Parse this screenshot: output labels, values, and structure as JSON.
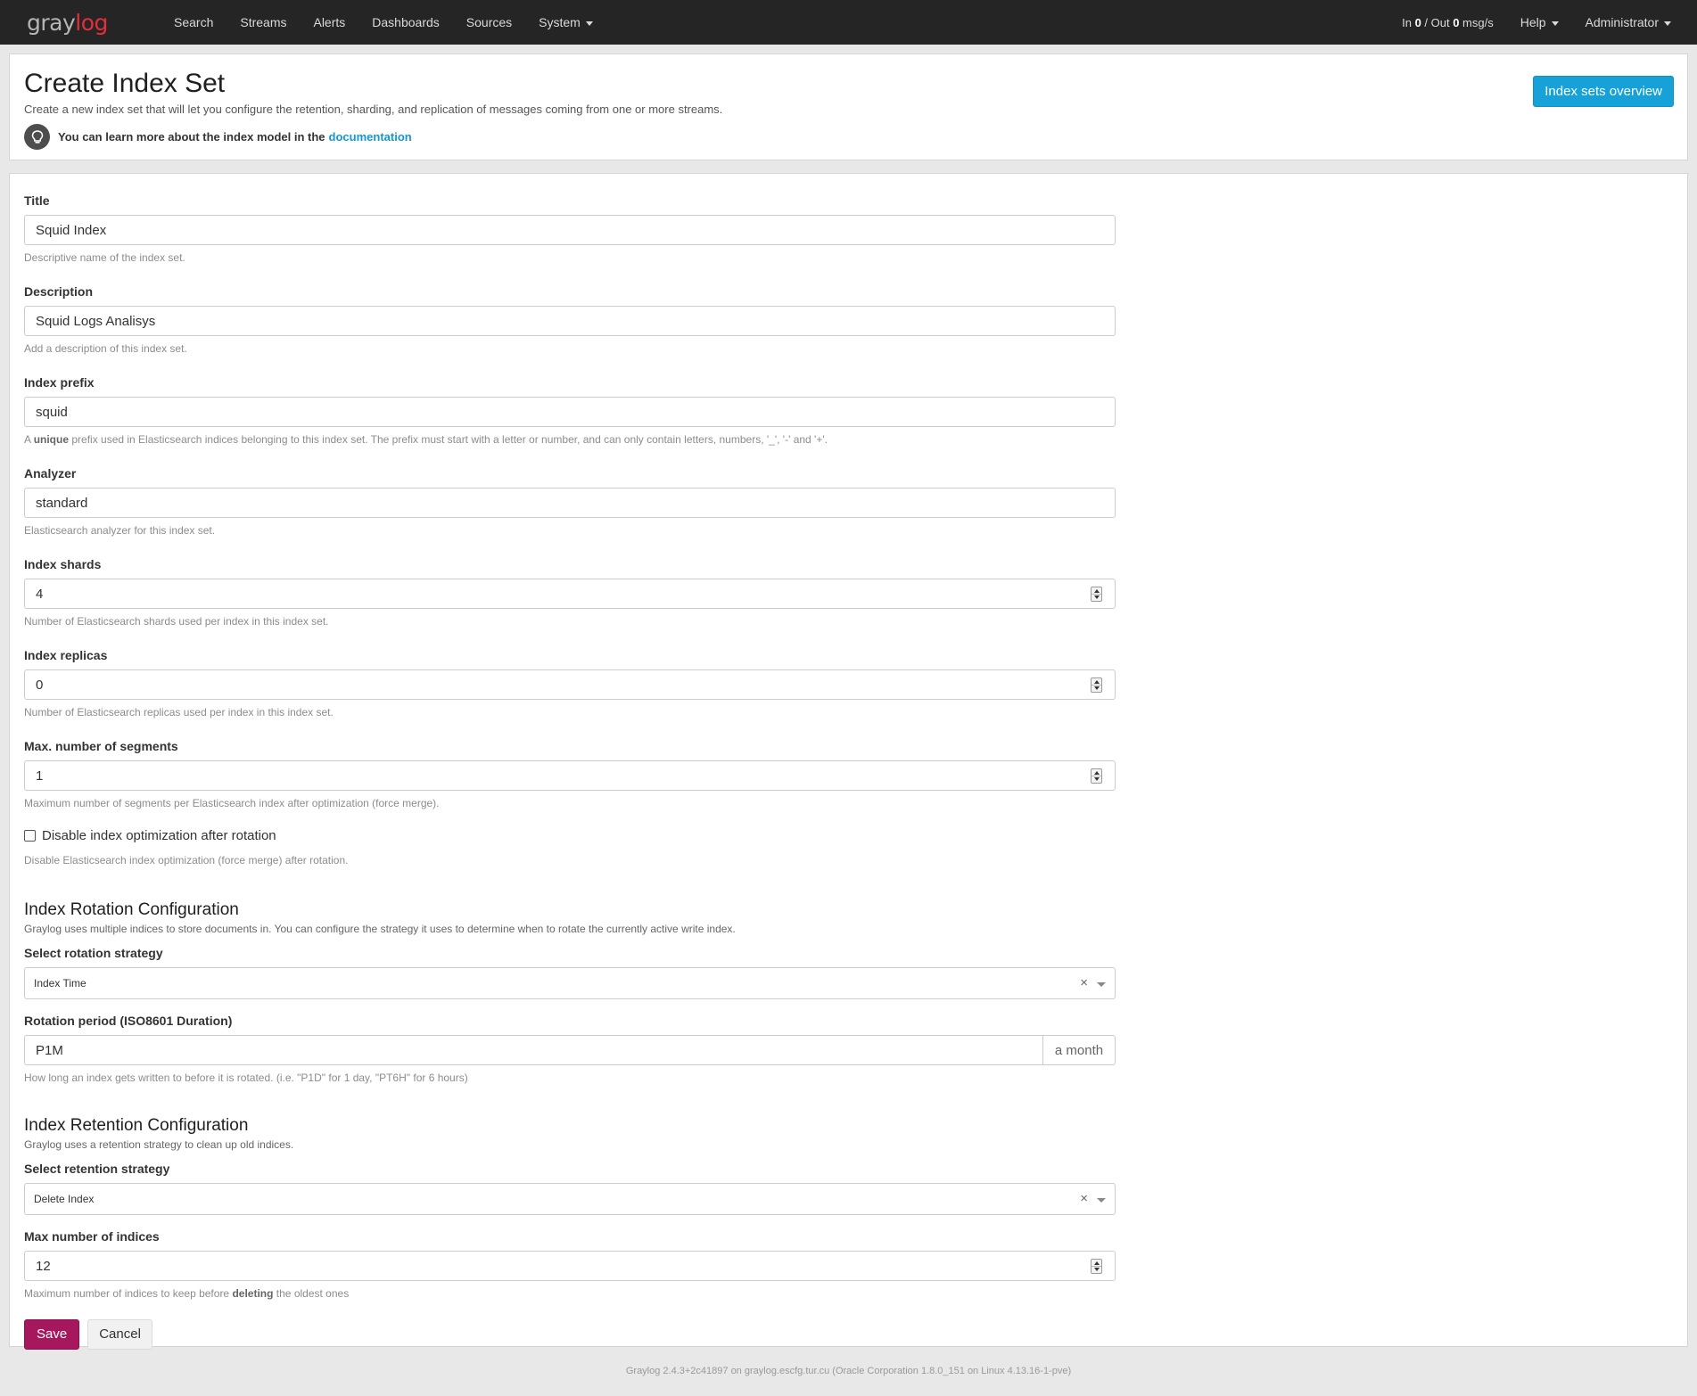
{
  "navbar": {
    "logo_part1": "gray",
    "logo_part2": "log",
    "items": [
      "Search",
      "Streams",
      "Alerts",
      "Dashboards",
      "Sources",
      "System"
    ],
    "throughput": {
      "in_label": "In ",
      "in_value": "0",
      "out_label": " / Out ",
      "out_value": "0",
      "unit": " msg/s"
    },
    "help": "Help",
    "user": "Administrator"
  },
  "header": {
    "title": "Create Index Set",
    "description": "Create a new index set that will let you configure the retention, sharding, and replication of messages coming from one or more streams.",
    "learn_text": "You can learn more about the index model in the",
    "learn_link": "documentation",
    "overview_button": "Index sets overview"
  },
  "form": {
    "title": {
      "label": "Title",
      "value": "Squid Index",
      "help": "Descriptive name of the index set."
    },
    "description": {
      "label": "Description",
      "value": "Squid Logs Analisys",
      "help": "Add a description of this index set."
    },
    "prefix": {
      "label": "Index prefix",
      "value": "squid",
      "help_pre": "A ",
      "help_bold": "unique",
      "help_post": " prefix used in Elasticsearch indices belonging to this index set. The prefix must start with a letter or number, and can only contain letters, numbers, '_', '-' and '+'."
    },
    "analyzer": {
      "label": "Analyzer",
      "value": "standard",
      "help": "Elasticsearch analyzer for this index set."
    },
    "shards": {
      "label": "Index shards",
      "value": "4",
      "help": "Number of Elasticsearch shards used per index in this index set."
    },
    "replicas": {
      "label": "Index replicas",
      "value": "0",
      "help": "Number of Elasticsearch replicas used per index in this index set."
    },
    "segments": {
      "label": "Max. number of segments",
      "value": "1",
      "help": "Maximum number of segments per Elasticsearch index after optimization (force merge)."
    },
    "disable_opt": {
      "label": "Disable index optimization after rotation",
      "checked": false,
      "help": "Disable Elasticsearch index optimization (force merge) after rotation."
    },
    "rotation": {
      "title": "Index Rotation Configuration",
      "description": "Graylog uses multiple indices to store documents in. You can configure the strategy it uses to determine when to rotate the currently active write index.",
      "strategy_label": "Select rotation strategy",
      "strategy_value": "Index Time",
      "period_label": "Rotation period (ISO8601 Duration)",
      "period_value": "P1M",
      "period_addon": "a month",
      "period_help": "How long an index gets written to before it is rotated. (i.e. \"P1D\" for 1 day, \"PT6H\" for 6 hours)"
    },
    "retention": {
      "title": "Index Retention Configuration",
      "description": "Graylog uses a retention strategy to clean up old indices.",
      "strategy_label": "Select retention strategy",
      "strategy_value": "Delete Index",
      "max_label": "Max number of indices",
      "max_value": "12",
      "help_pre": "Maximum number of indices to keep before ",
      "help_bold": "deleting",
      "help_post": " the oldest ones"
    },
    "save": "Save",
    "cancel": "Cancel"
  },
  "footer": "Graylog 2.4.3+2c41897 on graylog.escfg.tur.cu (Oracle Corporation 1.8.0_151 on Linux 4.13.16-1-pve)",
  "colors": {
    "navbar": "#252525",
    "primary": "#16a2d9",
    "save": "#a6175e",
    "logo_accent": "#e32f3a"
  }
}
